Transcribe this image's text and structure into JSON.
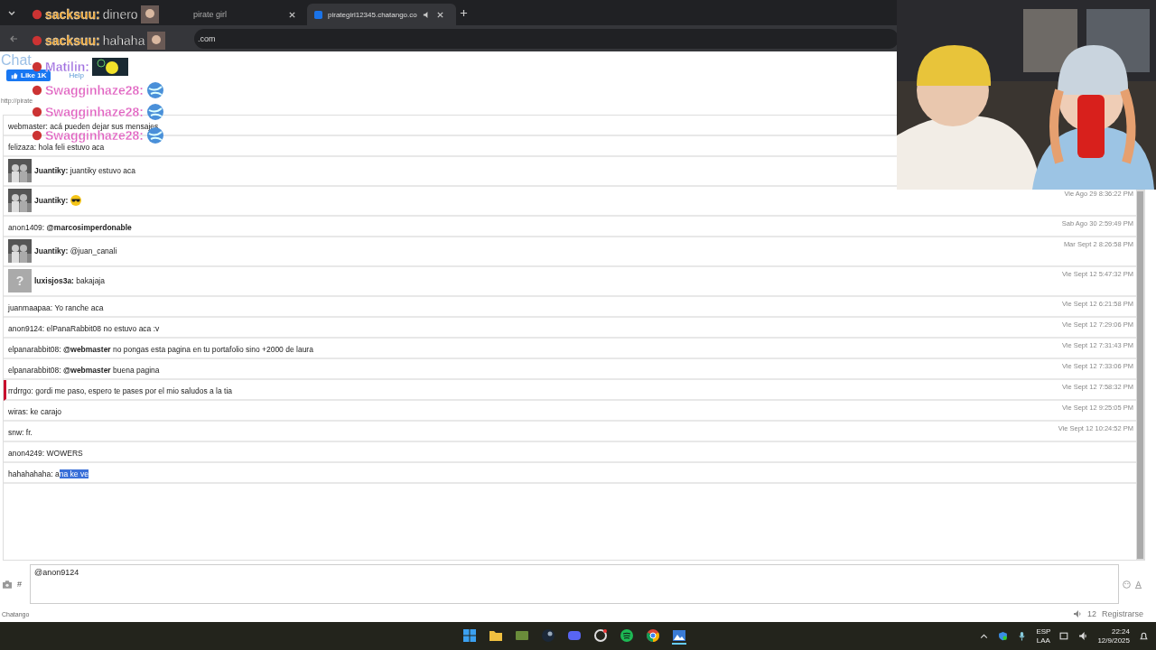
{
  "browser": {
    "tabs": [
      {
        "title": "pirate girl",
        "selected": false,
        "audio": false
      },
      {
        "title": "pirategirl12345.chatango.co",
        "selected": true,
        "audio": true
      }
    ],
    "url": ".com"
  },
  "chat": {
    "logo": "Chat",
    "like_button": "Like 1K",
    "help_link": "Help",
    "url": "http://pirate",
    "messages": [
      {
        "kind": "plain",
        "name": "webmaster:",
        "text": "acá pueden dejar sus mensajes",
        "flagged": false
      },
      {
        "kind": "plain",
        "name": "felizaza:",
        "text": "hola feli estuvo aca",
        "flagged": false
      },
      {
        "name": "Juantiky:",
        "text": "juantiky estuvo aca",
        "flagged": false
      },
      {
        "name": "Juantiky:",
        "emoji": true,
        "time": "Vie Ago 29 8:36:22 PM",
        "flagged": false
      },
      {
        "kind": "plain",
        "name": "anon1409:",
        "text": "**@marcosimperdonable**",
        "time": "Sab Ago 30 2:59:49 PM",
        "flagged": false
      },
      {
        "name": "Juantiky:",
        "text": "@juan_canali",
        "time": "Mar Sept 2 8:26:58 PM",
        "flagged": false
      },
      {
        "kind": "unknown",
        "name": "luxisjos3a:",
        "avatar_mark": "?",
        "text": "bakajaja",
        "time": "Vie Sept 12 5:47:32 PM",
        "flagged": false
      },
      {
        "kind": "plain",
        "name": "juanmaapaa:",
        "text": "Yo ranche aca",
        "time": "Vie Sept 12 6:21:58 PM",
        "flagged": false
      },
      {
        "kind": "plain",
        "name": "anon9124:",
        "text": "elPanaRabbit08 no estuvo aca :v",
        "time": "Vie Sept 12 7:29:06 PM",
        "flagged": false
      },
      {
        "kind": "plain",
        "name": "elpanarabbit08:",
        "text": "**@webmaster** no pongas esta pagina en tu portafolio sino +2000 de laura",
        "time": "Vie Sept 12 7:31:43 PM",
        "flagged": false
      },
      {
        "kind": "plain",
        "name": "elpanarabbit08:",
        "text": "**@webmaster** buena pagina",
        "time": "Vie Sept 12 7:33:06 PM",
        "flagged": false
      },
      {
        "kind": "plain",
        "name": "rrdrrgo:",
        "text": "gordi me paso, espero te pases por el mio saludos a la tia",
        "time": "Vie Sept 12 7:58:32 PM",
        "flagged": true
      },
      {
        "kind": "plain",
        "name": "wiras:",
        "text": "ke carajo",
        "time": "Vie Sept 12 9:25:05 PM",
        "flagged": false
      },
      {
        "kind": "plain",
        "name": "snw:",
        "text": "fr.",
        "time": "Vie Sept 12 10:24:52 PM",
        "flagged": false
      },
      {
        "kind": "plain",
        "name": "anon4249:",
        "text": "WOWERS",
        "flagged": false
      },
      {
        "kind": "plain",
        "name": "hahahahaha:",
        "text": "a",
        "selected_text": "na ke ve",
        "flagged": false
      }
    ],
    "input": {
      "value": "@anon9124"
    },
    "hash": "#",
    "brand": "Chatango",
    "user_count": "12",
    "register_link": "Registrarse"
  },
  "stream_overlay": [
    {
      "user": "sacksuu:",
      "message": "dinero",
      "color": "#f0a020"
    },
    {
      "user": "sacksuu:",
      "message": "hahaha",
      "color": "#f0a020"
    },
    {
      "user": "Matilin:",
      "color": "#a070e0",
      "kind": "fish"
    },
    {
      "user": "Swagginhaze28:",
      "color": "#e060c0",
      "kind": "globe"
    },
    {
      "user": "Swagginhaze28:",
      "color": "#e060c0",
      "kind": "globe"
    },
    {
      "user": "Swagginhaze28:",
      "color": "#e060c0",
      "kind": "globe"
    }
  ],
  "taskbar": {
    "language": "ESP",
    "layout": "LAA",
    "time": "22:24",
    "date": "12/9/2025"
  }
}
